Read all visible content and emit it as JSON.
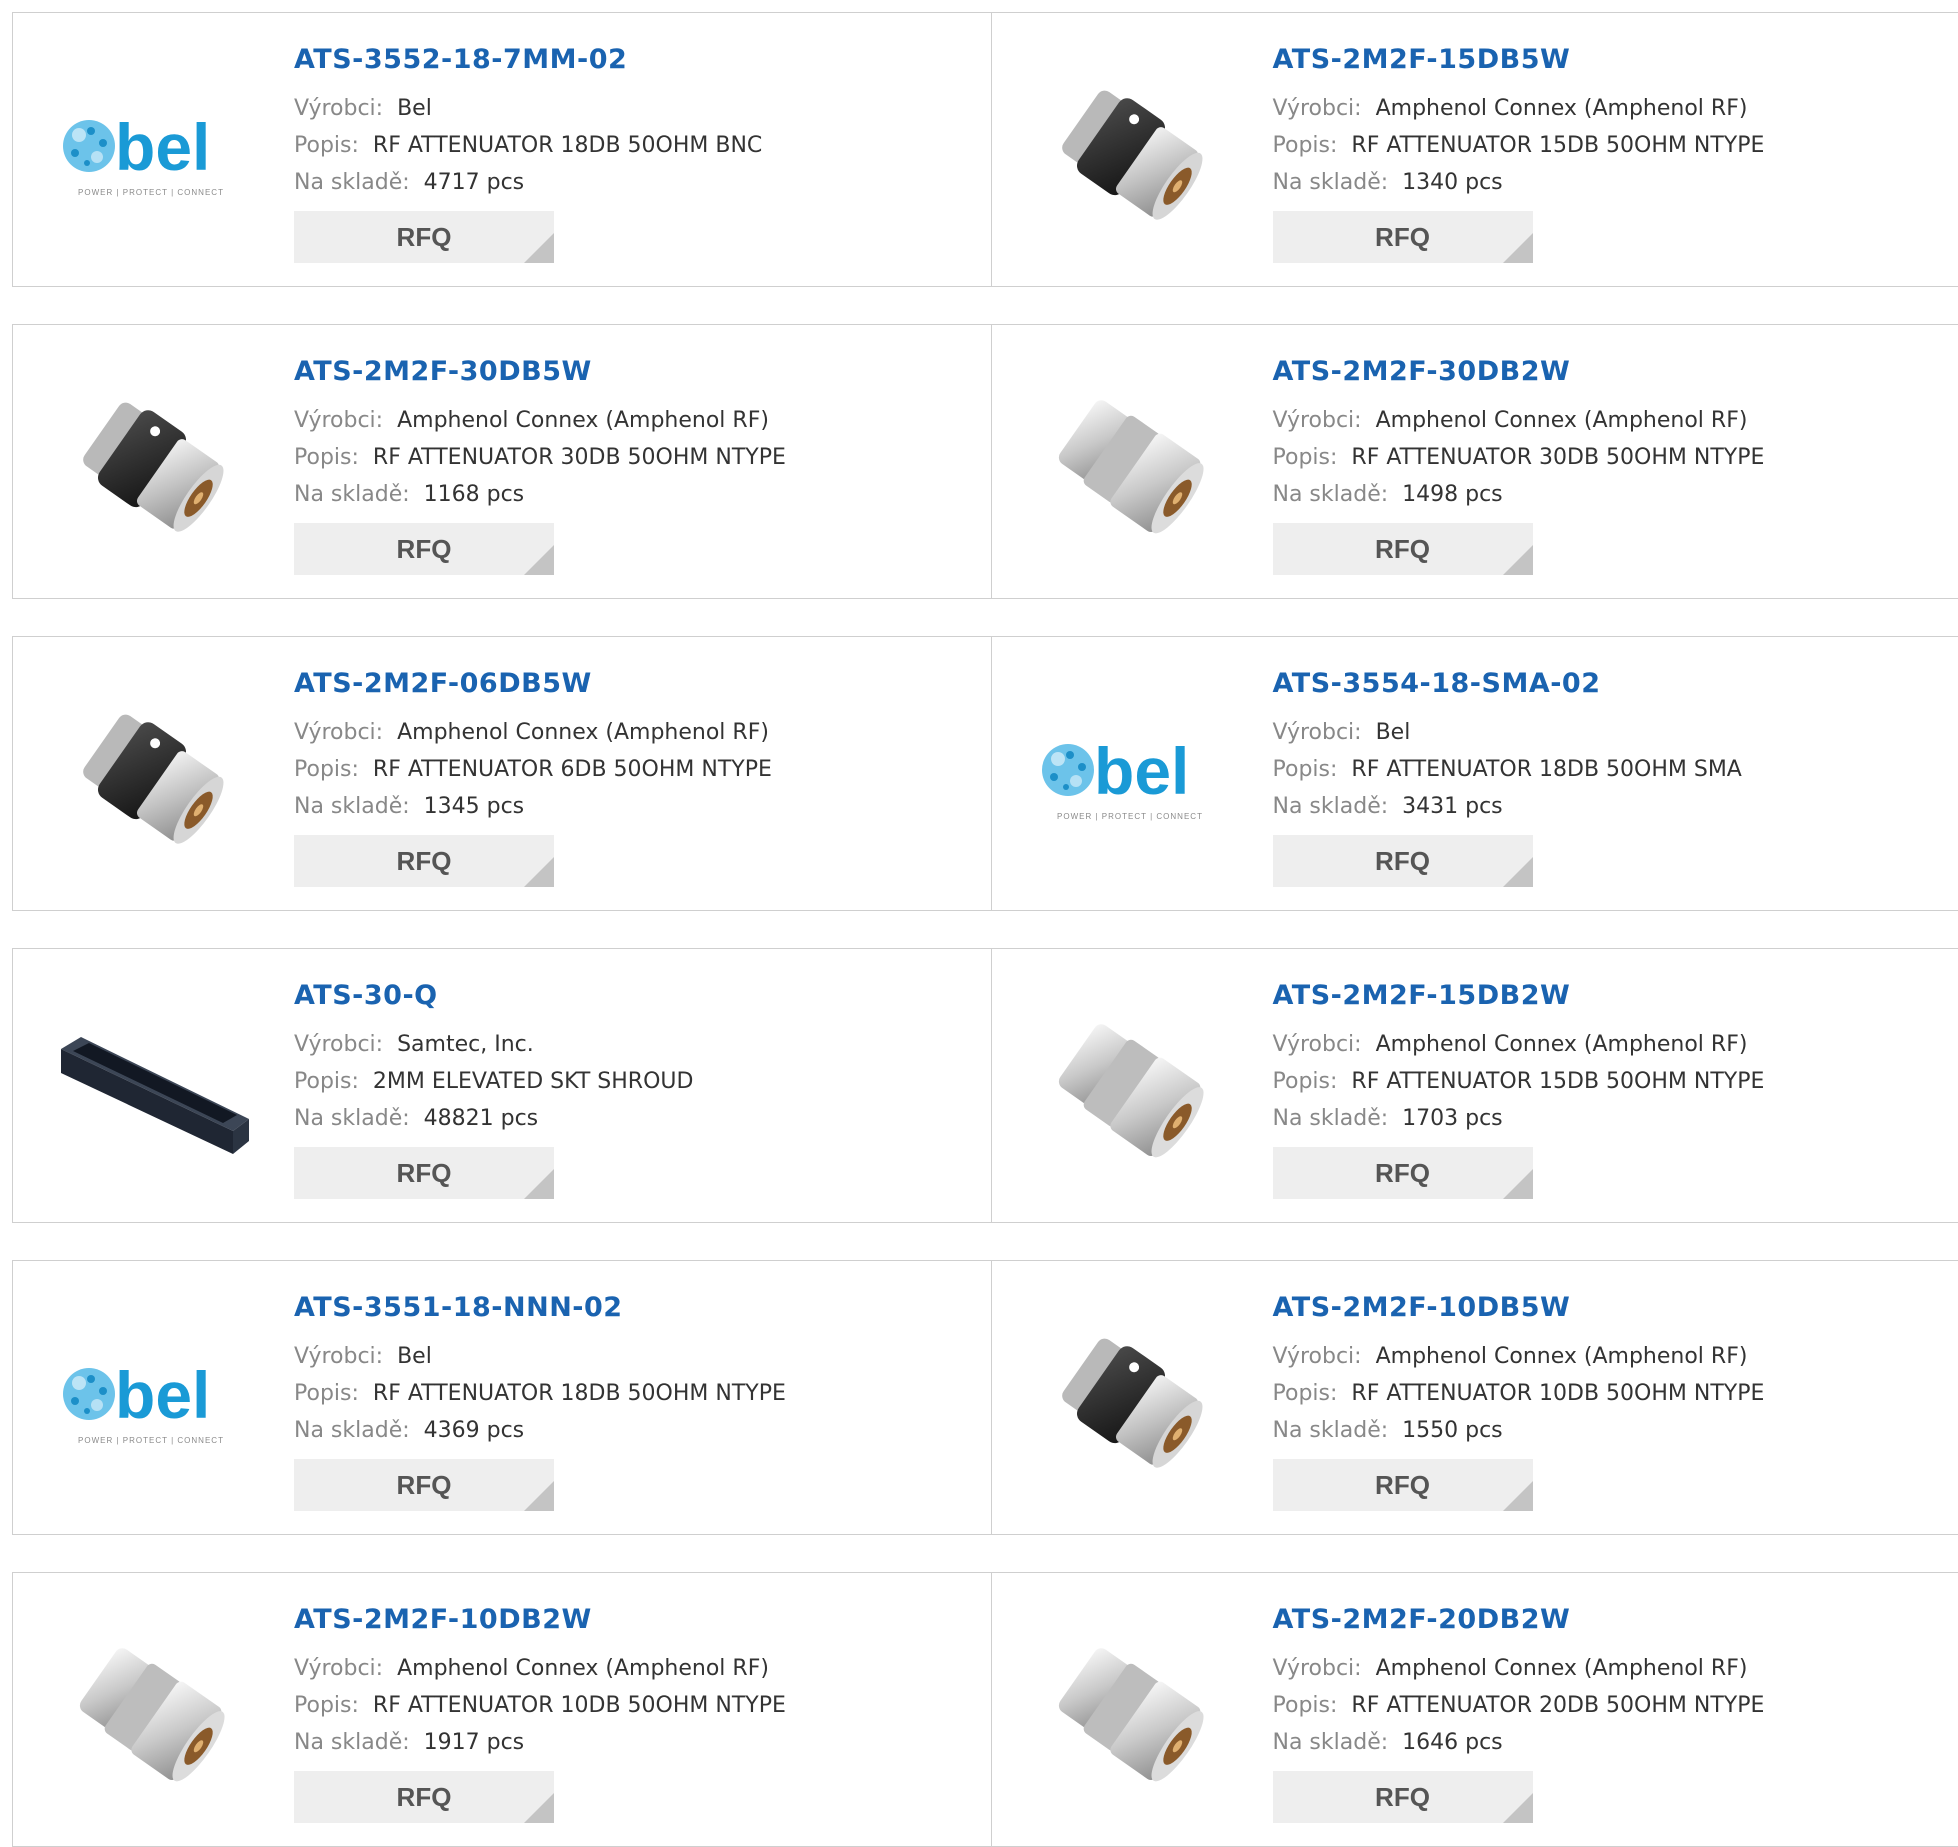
{
  "labels": {
    "manufacturer": "Výrobci:",
    "description": "Popis:",
    "stock": "Na skladě:",
    "rfq": "RFQ"
  },
  "colors": {
    "part_number": "#1a63b0",
    "label": "#888888",
    "border": "#cfcfcf",
    "rfq_bg": "#eeeeee"
  },
  "rows": [
    {
      "left": {
        "part": "ATS-3552-18-7MM-02",
        "manufacturer": "Bel",
        "description": "RF ATTENUATOR 18DB 50OHM BNC",
        "stock": "4717 pcs",
        "image": "bel-logo"
      },
      "right": {
        "part": "ATS-2M2F-15DB5W",
        "manufacturer": "Amphenol Connex (Amphenol RF)",
        "description": "RF ATTENUATOR 15DB 50OHM NTYPE",
        "stock": "1340 pcs",
        "image": "attenuator-black"
      }
    },
    {
      "left": {
        "part": "ATS-2M2F-30DB5W",
        "manufacturer": "Amphenol Connex (Amphenol RF)",
        "description": "RF ATTENUATOR 30DB 50OHM NTYPE",
        "stock": "1168 pcs",
        "image": "attenuator-black"
      },
      "right": {
        "part": "ATS-2M2F-30DB2W",
        "manufacturer": "Amphenol Connex (Amphenol RF)",
        "description": "RF ATTENUATOR 30DB 50OHM NTYPE",
        "stock": "1498 pcs",
        "image": "attenuator-silver"
      }
    },
    {
      "left": {
        "part": "ATS-2M2F-06DB5W",
        "manufacturer": "Amphenol Connex (Amphenol RF)",
        "description": "RF ATTENUATOR 6DB 50OHM NTYPE",
        "stock": "1345 pcs",
        "image": "attenuator-black"
      },
      "right": {
        "part": "ATS-3554-18-SMA-02",
        "manufacturer": "Bel",
        "description": "RF ATTENUATOR 18DB 50OHM SMA",
        "stock": "3431 pcs",
        "image": "bel-logo"
      }
    },
    {
      "left": {
        "part": "ATS-30-Q",
        "manufacturer": "Samtec, Inc.",
        "description": "2MM ELEVATED SKT SHROUD",
        "stock": "48821 pcs",
        "image": "shroud"
      },
      "right": {
        "part": "ATS-2M2F-15DB2W",
        "manufacturer": "Amphenol Connex (Amphenol RF)",
        "description": "RF ATTENUATOR 15DB 50OHM NTYPE",
        "stock": "1703 pcs",
        "image": "attenuator-silver"
      }
    },
    {
      "left": {
        "part": "ATS-3551-18-NNN-02",
        "manufacturer": "Bel",
        "description": "RF ATTENUATOR 18DB 50OHM NTYPE",
        "stock": "4369 pcs",
        "image": "bel-logo"
      },
      "right": {
        "part": "ATS-2M2F-10DB5W",
        "manufacturer": "Amphenol Connex (Amphenol RF)",
        "description": "RF ATTENUATOR 10DB 50OHM NTYPE",
        "stock": "1550 pcs",
        "image": "attenuator-black"
      }
    },
    {
      "left": {
        "part": "ATS-2M2F-10DB2W",
        "manufacturer": "Amphenol Connex (Amphenol RF)",
        "description": "RF ATTENUATOR 10DB 50OHM NTYPE",
        "stock": "1917 pcs",
        "image": "attenuator-silver"
      },
      "right": {
        "part": "ATS-2M2F-20DB2W",
        "manufacturer": "Amphenol Connex (Amphenol RF)",
        "description": "RF ATTENUATOR 20DB 50OHM NTYPE",
        "stock": "1646 pcs",
        "image": "attenuator-silver"
      }
    }
  ]
}
